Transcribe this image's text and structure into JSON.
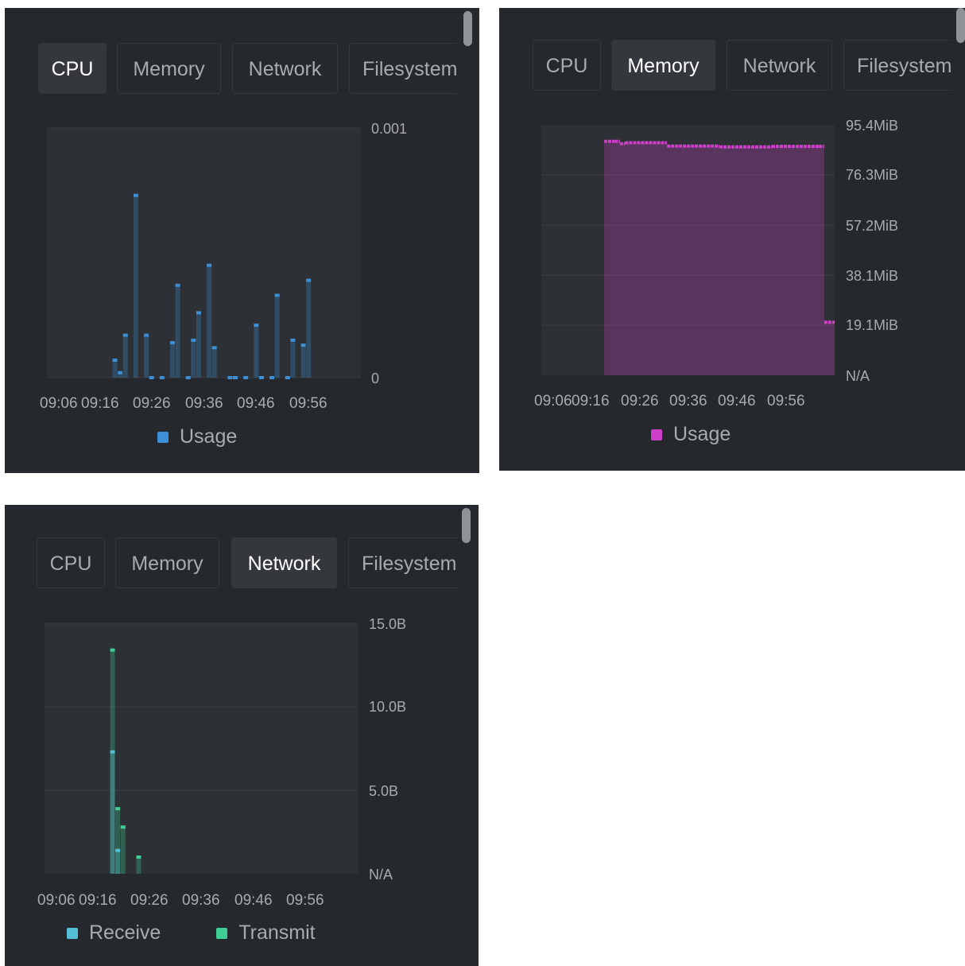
{
  "panels": [
    {
      "tabs": [
        "CPU",
        "Memory",
        "Network",
        "Filesystem"
      ],
      "active_tab": "CPU",
      "legend": [
        {
          "label": "Usage",
          "color": "#3d8fd6"
        }
      ]
    },
    {
      "tabs": [
        "CPU",
        "Memory",
        "Network",
        "Filesystem"
      ],
      "active_tab": "Memory",
      "legend": [
        {
          "label": "Usage",
          "color": "#cc3fc7"
        }
      ]
    },
    {
      "tabs": [
        "CPU",
        "Memory",
        "Network",
        "Filesystem"
      ],
      "active_tab": "Network",
      "legend": [
        {
          "label": "Receive",
          "color": "#54bfd6"
        },
        {
          "label": "Transmit",
          "color": "#3dcf94"
        }
      ]
    }
  ],
  "chart_data": [
    {
      "type": "bar",
      "panel": "CPU",
      "x_ticks": [
        "09:06",
        "09:16",
        "09:26",
        "09:36",
        "09:46",
        "09:56"
      ],
      "y_ticks": [
        "0.001",
        "0"
      ],
      "ylim": [
        0,
        0.001
      ],
      "grid": true,
      "legend_position": "bottom",
      "series": [
        {
          "name": "Usage",
          "color": "#3d8fd6",
          "x": [
            "09:19",
            "09:20",
            "09:21",
            "09:23",
            "09:25",
            "09:26",
            "09:28",
            "09:30",
            "09:31",
            "09:33",
            "09:34",
            "09:35",
            "09:37",
            "09:38",
            "09:41",
            "09:42",
            "09:44",
            "09:46",
            "09:47",
            "09:49",
            "09:50",
            "09:52",
            "09:53",
            "09:55",
            "09:56"
          ],
          "values": [
            7e-05,
            2e-05,
            0.00017,
            0.00073,
            0.00017,
            0.0,
            0.0,
            0.00014,
            0.00037,
            0.0,
            0.00015,
            0.00026,
            0.00045,
            0.00012,
            0.0,
            0.0,
            0.0,
            0.00021,
            0.0,
            0.0,
            0.00033,
            0.0,
            0.00015,
            0.00013,
            0.00039
          ]
        }
      ]
    },
    {
      "type": "area",
      "panel": "Memory",
      "x_ticks": [
        "09:06",
        "09:16",
        "09:26",
        "09:36",
        "09:46",
        "09:56"
      ],
      "y_ticks": [
        "95.4MiB",
        "76.3MiB",
        "57.2MiB",
        "38.1MiB",
        "19.1MiB",
        "N/A"
      ],
      "ylim": [
        0,
        95.4
      ],
      "y_unit": "MiB",
      "grid": true,
      "legend_position": "bottom",
      "series": [
        {
          "name": "Usage",
          "color": "#cc3fc7",
          "x": [
            "09:18",
            "09:20",
            "09:21",
            "09:22",
            "09:30",
            "09:40",
            "09:50",
            "09:59",
            "10:00",
            "10:02"
          ],
          "values": [
            89.1,
            89.1,
            88.2,
            88.6,
            87.3,
            87.0,
            87.2,
            87.2,
            20.2,
            20.2
          ]
        }
      ]
    },
    {
      "type": "bar",
      "panel": "Network",
      "x_ticks": [
        "09:06",
        "09:16",
        "09:26",
        "09:36",
        "09:46",
        "09:56"
      ],
      "y_ticks": [
        "15.0B",
        "10.0B",
        "5.0B",
        "N/A"
      ],
      "ylim": [
        0,
        15
      ],
      "y_unit": "B",
      "grid": true,
      "legend_position": "bottom",
      "series": [
        {
          "name": "Receive",
          "color": "#54bfd6",
          "x": [
            "09:19",
            "09:20"
          ],
          "values": [
            7.3,
            1.4
          ]
        },
        {
          "name": "Transmit",
          "color": "#3dcf94",
          "x": [
            "09:19",
            "09:20",
            "09:21",
            "09:24"
          ],
          "values": [
            13.4,
            3.9,
            2.8,
            1.0
          ]
        }
      ]
    }
  ]
}
